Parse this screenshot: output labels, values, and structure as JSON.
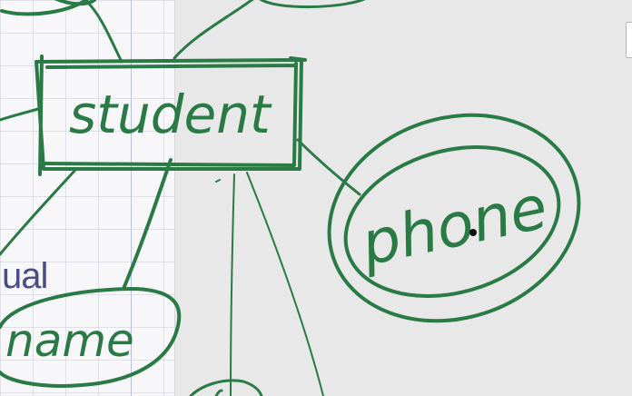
{
  "slide": {
    "partial_text": "ual"
  },
  "diagram": {
    "entity_label": "student",
    "multivalued_attribute_label": "phone",
    "attribute_label": "name"
  },
  "colors": {
    "ink": "#2a7a45",
    "slide_text": "#4a4d86",
    "canvas": "#e8e8e8",
    "grid_panel": "#f7f7f9"
  }
}
